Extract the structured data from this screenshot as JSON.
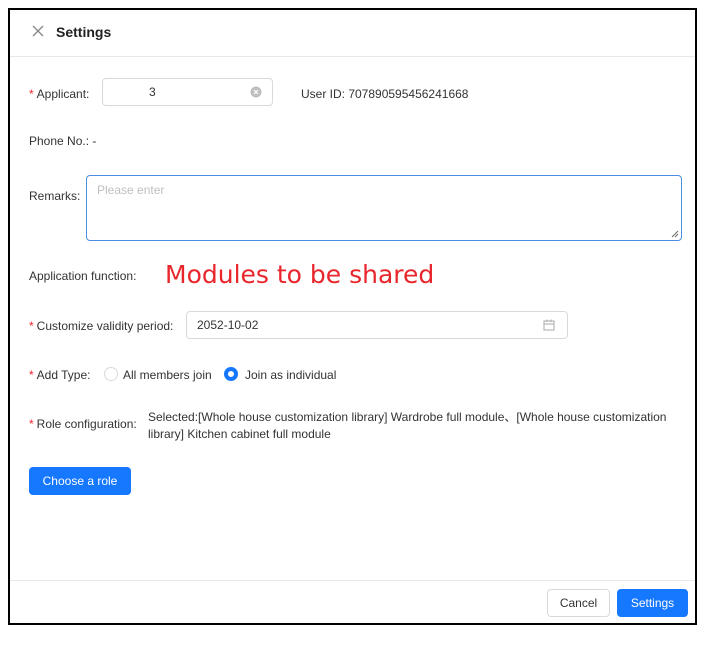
{
  "dialog": {
    "title": "Settings"
  },
  "applicant": {
    "label": "Applicant:",
    "value": "3",
    "user_id_label": "User ID: 707890595456241668"
  },
  "phone": {
    "label": "Phone No.: -"
  },
  "remarks": {
    "label": "Remarks:",
    "placeholder": "Please enter"
  },
  "application_function": {
    "label": "Application function:",
    "note": "Modules to be shared"
  },
  "validity": {
    "label": "Customize validity period:",
    "value": "2052-10-02"
  },
  "add_type": {
    "label": "Add Type:",
    "options": [
      {
        "label": "All members join",
        "selected": false
      },
      {
        "label": "Join as individual",
        "selected": true
      }
    ]
  },
  "role": {
    "label": "Role configuration:",
    "selected_text": "Selected:[Whole house customization library] Wardrobe full module、[Whole house customization library] Kitchen cabinet full module",
    "choose_button": "Choose a role"
  },
  "footer": {
    "cancel": "Cancel",
    "settings": "Settings"
  },
  "colors": {
    "primary": "#1677ff",
    "required": "#f5222d",
    "annotation": "#e8262b"
  }
}
